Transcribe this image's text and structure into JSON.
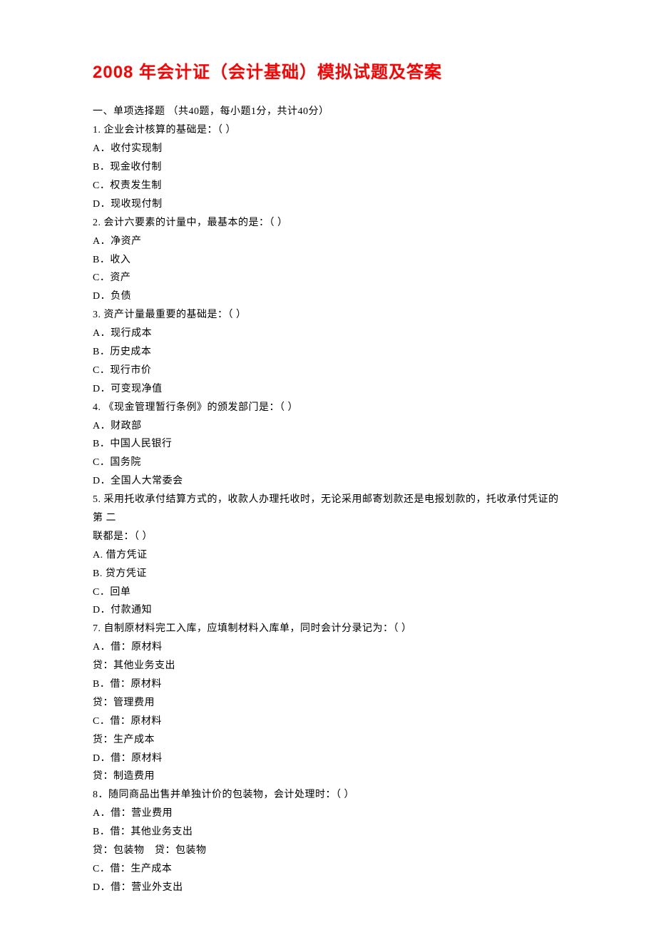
{
  "title": "2008 年会计证（会计基础）模拟试题及答案",
  "lines": [
    "一、单项选择题 （共40题，每小题1分，共计40分）",
    "1.  企业会计核算的基础是：（ ）",
    "A．收付实现制",
    "B．现金收付制",
    "C．权责发生制",
    "D．现收现付制",
    "2.  会计六要素的计量中，最基本的是：（ ）",
    "A．净资产",
    "B．收入",
    "C．资产",
    "D．负债",
    "3.  资产计量最重要的基础是：（ ）",
    "A．现行成本",
    "B．历史成本",
    "C．现行市价",
    "D．可变现净值",
    "4.  《现金管理暂行条例》的颁发部门是：（ ）",
    "A．财政部",
    "B．中国人民银行",
    "C．国务院",
    "D．全国人大常委会",
    "5.  采用托收承付结算方式的，收款人办理托收时，无论采用邮寄划款还是电报划款的，托收承付凭证的第 二",
    "联都是：（ ）",
    "A. 借方凭证",
    "B. 贷方凭证",
    "C．回单",
    "D．付款通知",
    "7. 自制原材料完工入库，应填制材料入库单，同时会计分录记为：（ ）",
    "A．借：原材料",
    "贷：其他业务支出",
    "B．借：原材料",
    "贷：管理费用",
    "C．借：原材料",
    "货：生产成本",
    "D．借：原材料",
    "贷：制造费用",
    "8．随同商品出售并单独计价的包装物，会计处理时：（ ）",
    "A．借：营业费用",
    "B．借：其他业务支出",
    "贷：包装物　贷：包装物",
    "C．借：生产成本",
    "D．借：营业外支出"
  ]
}
